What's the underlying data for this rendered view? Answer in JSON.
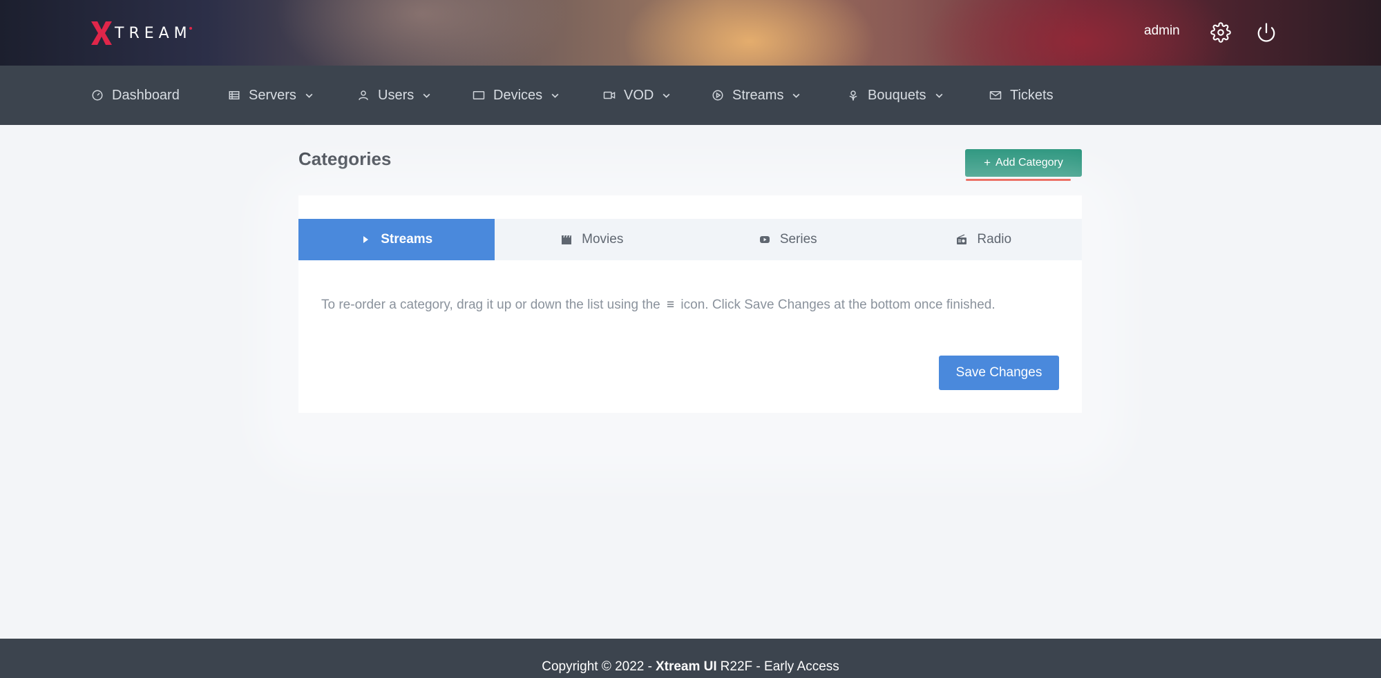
{
  "header": {
    "logo_text": "TREAM",
    "username": "admin",
    "icons": {
      "settings": "gear-icon",
      "logout": "power-icon"
    }
  },
  "nav": {
    "items": [
      {
        "label": "Dashboard",
        "icon": "dashboard-icon",
        "dropdown": false
      },
      {
        "label": "Servers",
        "icon": "servers-icon",
        "dropdown": true
      },
      {
        "label": "Users",
        "icon": "user-icon",
        "dropdown": true
      },
      {
        "label": "Devices",
        "icon": "device-icon",
        "dropdown": true
      },
      {
        "label": "VOD",
        "icon": "video-camera-icon",
        "dropdown": true
      },
      {
        "label": "Streams",
        "icon": "play-circle-icon",
        "dropdown": true
      },
      {
        "label": "Bouquets",
        "icon": "flower-icon",
        "dropdown": true
      },
      {
        "label": "Tickets",
        "icon": "envelope-icon",
        "dropdown": false
      }
    ]
  },
  "page": {
    "title": "Categories",
    "add_button": "Add Category",
    "tabs": [
      {
        "label": "Streams",
        "icon": "play-icon",
        "active": true
      },
      {
        "label": "Movies",
        "icon": "clapperboard-icon",
        "active": false
      },
      {
        "label": "Series",
        "icon": "youtube-icon",
        "active": false
      },
      {
        "label": "Radio",
        "icon": "radio-icon",
        "active": false
      }
    ],
    "hint_before": "To re-order a category, drag it up or down the list using the",
    "hint_icon": "≡",
    "hint_after": "icon. Click Save Changes at the bottom once finished.",
    "save_button": "Save Changes"
  },
  "footer": {
    "prefix": "Copyright © 2022 -",
    "brand": "Xtream UI",
    "suffix": "R22F - Early Access"
  },
  "colors": {
    "accent_blue": "#4a89dc",
    "accent_green": "#1e8f76",
    "nav_bg": "#3c444e",
    "logo_red": "#e0264a",
    "highlight_underline": "#e53a2a"
  }
}
